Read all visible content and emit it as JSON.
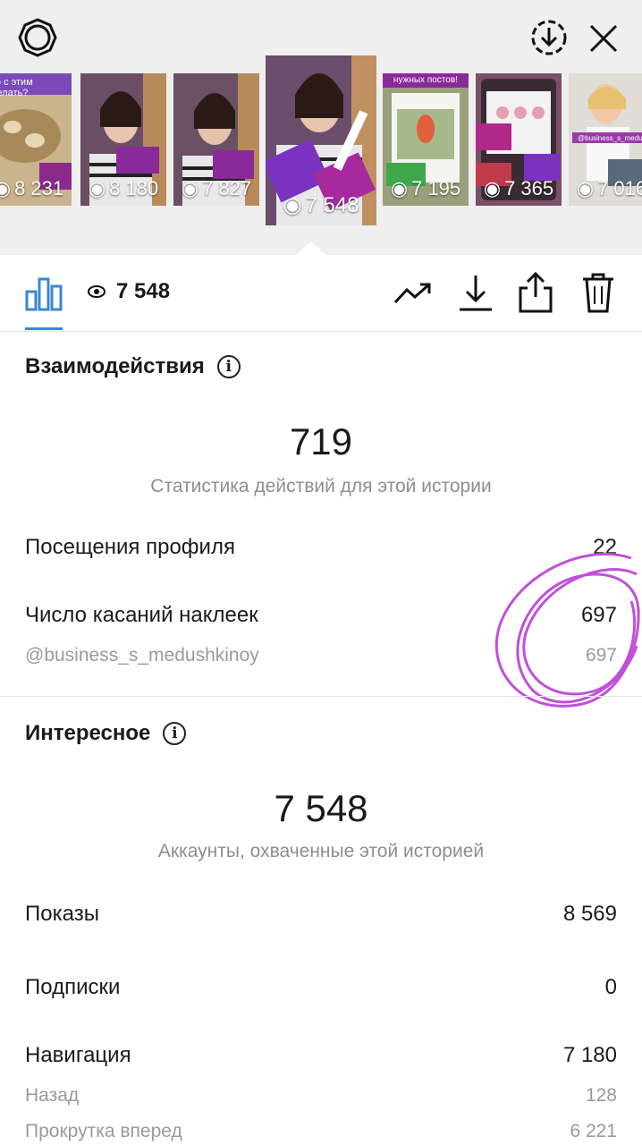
{
  "header": {
    "settings_icon": "gear-icon",
    "download_icon": "download-circle-icon",
    "close_icon": "close-icon"
  },
  "thumbnails": [
    {
      "views": "8 231",
      "bg": "#d8c6a0",
      "overlay_text": "то с этим делать?"
    },
    {
      "views": "8 180",
      "bg": "#7a5a70"
    },
    {
      "views": "7 827",
      "bg": "#6f5a6a"
    },
    {
      "views": "7 548",
      "bg": "#6c4f6e",
      "active": true
    },
    {
      "views": "7 195",
      "bg": "#8fb06a",
      "overlay_text": "нужных постов!"
    },
    {
      "views": "7 365",
      "bg": "#b05a8a"
    },
    {
      "views": "7 016",
      "bg": "#d9d4cf",
      "overlay_text": "@business_s_medushkinoy"
    }
  ],
  "toolbar": {
    "views": "7 548",
    "insights_icon": "bar-chart-icon",
    "eye_icon": "eye-icon",
    "promote_icon": "trending-up-icon",
    "save_icon": "download-icon",
    "share_icon": "share-icon",
    "delete_icon": "trash-icon"
  },
  "interactions": {
    "title": "Взаимодействия",
    "total": "719",
    "caption": "Статистика действий для этой истории",
    "rows": [
      {
        "label": "Посещения профиля",
        "value": "22"
      },
      {
        "label": "Число касаний наклеек",
        "value": "697"
      }
    ],
    "sub_rows": [
      {
        "label": "@business_s_medushkinoy",
        "value": "697"
      }
    ]
  },
  "discovery": {
    "title": "Интересное",
    "total": "7 548",
    "caption": "Аккаунты, охваченные этой историей",
    "rows": [
      {
        "label": "Показы",
        "value": "8 569"
      },
      {
        "label": "Подписки",
        "value": "0"
      },
      {
        "label": "Навигация",
        "value": "7 180"
      }
    ],
    "sub_rows": [
      {
        "label": "Назад",
        "value": "128"
      },
      {
        "label": "Прокрутка вперед",
        "value": "6 221"
      }
    ]
  },
  "colors": {
    "accent": "#3a86d6",
    "annotation": "#c050d8"
  }
}
